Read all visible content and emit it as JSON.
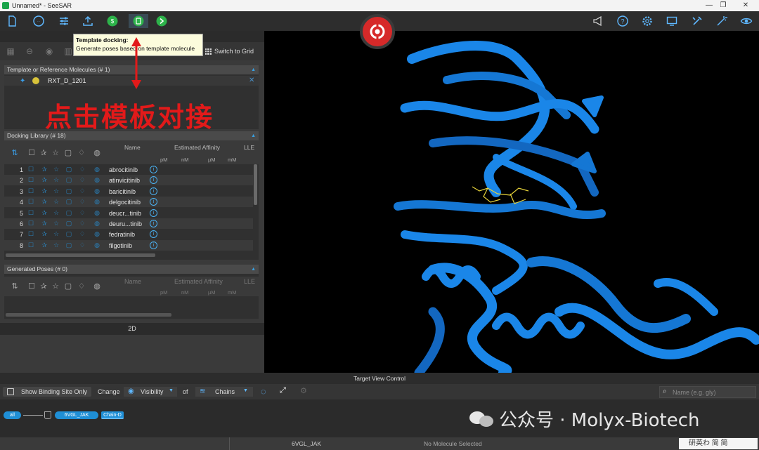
{
  "window": {
    "title": "Unnamed* - SeeSAR",
    "controls": [
      "—",
      "❐",
      "✕"
    ]
  },
  "toolbar": {
    "left_icons": [
      "file-icon",
      "analyzer-icon",
      "settings-sliders-icon",
      "upload-icon",
      "binding-site-icon",
      "template-docking-icon",
      "docking-icon"
    ],
    "right_icons": [
      "megaphone-icon",
      "help-icon",
      "gear-icon",
      "monitor-icon",
      "tools-icon",
      "wand-icon",
      "eye-icon"
    ],
    "active_icon": "template-docking-icon"
  },
  "tooltip": {
    "title": "Template docking:",
    "text": "Generate poses based on template molecule"
  },
  "switch_grid_label": "Switch to Grid",
  "annotation": {
    "text": "点击模板对接"
  },
  "template_section": {
    "title": "Template or Reference Molecules (# 1)",
    "molecule": "RXT_D_1201"
  },
  "docking_library": {
    "title": "Docking Library (# 18)",
    "headers": {
      "name": "Name",
      "affinity": "Estimated Affinity",
      "lle": "LLE",
      "units": [
        "pM",
        "nM",
        "µM",
        "mM"
      ]
    },
    "rows": [
      {
        "num": "1",
        "name": "abrocitinib"
      },
      {
        "num": "2",
        "name": "atinvicitinib"
      },
      {
        "num": "3",
        "name": "baricitinib"
      },
      {
        "num": "4",
        "name": "delgocitinib"
      },
      {
        "num": "5",
        "name": "deucr...tinib"
      },
      {
        "num": "6",
        "name": "deuru...tinib"
      },
      {
        "num": "7",
        "name": "fedratinib"
      },
      {
        "num": "8",
        "name": "filgotinib"
      }
    ]
  },
  "generated_poses": {
    "title": "Generated Poses (# 0)",
    "headers": {
      "name": "Name",
      "affinity": "Estimated Affinity",
      "lle": "LLE",
      "units": [
        "pM",
        "nM",
        "µM",
        "mM"
      ]
    }
  },
  "panel_2d_label": "2D",
  "target_view": {
    "title": "Target View Control",
    "show_binding_site": "Show Binding Site Only",
    "change": "Change",
    "visibility": "Visibility",
    "of": "of",
    "chains": "Chains",
    "search_placeholder": "Name (e.g. gly)",
    "pills": {
      "all": "all",
      "structure": "6VGL_JAK",
      "chain": "Chain-D"
    }
  },
  "status": {
    "structure": "6VGL_JAK",
    "molecule": "No Molecule Selected",
    "corner": "研英わ 简 简"
  },
  "watermark": {
    "text": "公众号 · Molyx-Biotech"
  },
  "colors": {
    "accent": "#1f8fd6",
    "annotation_red": "#e21a1a",
    "protein_blue": "#1a86e8",
    "ligand": "#e8d43a"
  }
}
